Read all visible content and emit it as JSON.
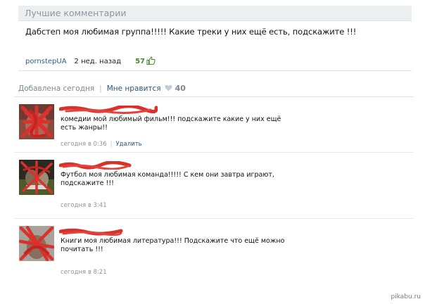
{
  "best_comments": {
    "header": "Лучшие комментарии",
    "text": "Дабстеп моя любимая группа!!!!! Какие треки у них ещё есть, подскажите !!!",
    "author": "pornstepUA",
    "time": "2 нед. назад",
    "likes": "57"
  },
  "post_footer": {
    "added": "Добавлена сегодня",
    "like_label": "Мне нравится",
    "like_count": "40"
  },
  "comments": [
    {
      "text": "комедии мой любимый фильм!!! подскажите какие у них ещё есть жанры!!",
      "time": "сегодня в 0:36",
      "delete_label": "Удалить"
    },
    {
      "text": "Футбол моя любимая команда!!!!! С кем они завтра играют, подскажите !!!",
      "time": "сегодня в 3:41"
    },
    {
      "text": "Книги моя любимая литература!!! Подскажите что ещё можно почитать !!!",
      "time": "сегодня в 8:21"
    }
  ],
  "watermark": "pikabu.ru",
  "colors": {
    "link": "#2b587a",
    "header_bg": "#eceff2",
    "likes_green": "#3d8b2a",
    "redaction_red": "#d9312b"
  }
}
